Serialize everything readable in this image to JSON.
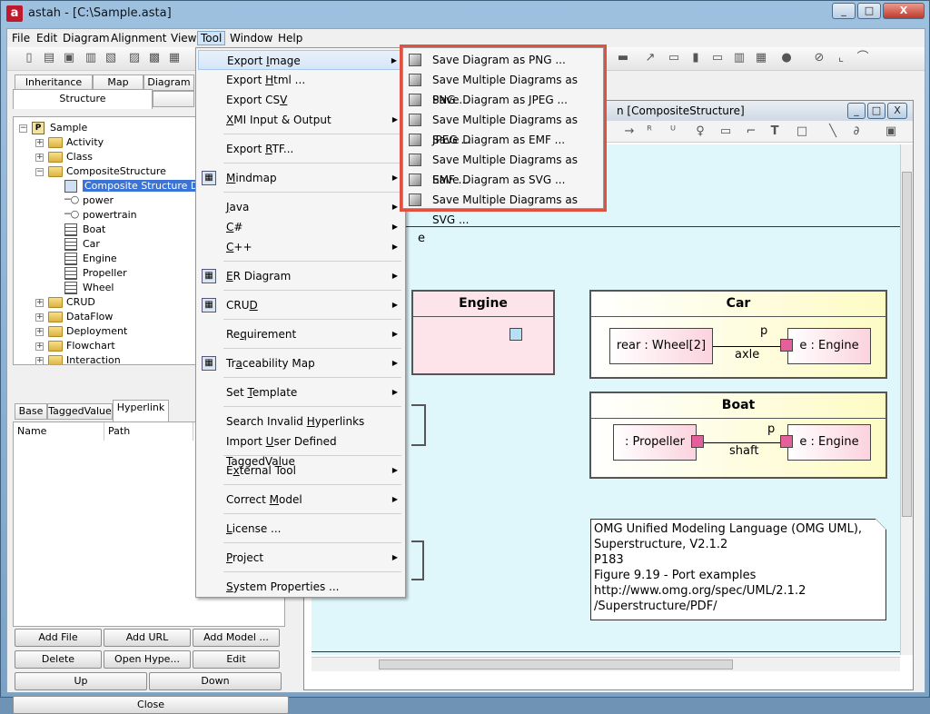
{
  "window": {
    "app_icon_text": "a",
    "title": "astah - [C:\\Sample.asta]",
    "min_btn": "_",
    "max_btn": "□",
    "close_btn": "X"
  },
  "menubar": [
    "File",
    "Edit",
    "Diagram",
    "Alignment",
    "View",
    "Tool",
    "Window",
    "Help"
  ],
  "left_tabs_row1": [
    "Inheritance",
    "Map",
    "Diagram"
  ],
  "left_tab_structure": "Structure",
  "tree": [
    {
      "label": "Sample",
      "indent": 0,
      "kind": "pkg",
      "exp": "-"
    },
    {
      "label": "Activity",
      "indent": 1,
      "kind": "folder",
      "exp": "+"
    },
    {
      "label": "Class",
      "indent": 1,
      "kind": "folder",
      "exp": "+"
    },
    {
      "label": "CompositeStructure",
      "indent": 1,
      "kind": "folder",
      "exp": "-"
    },
    {
      "label": "Composite Structure Diagr",
      "indent": 2,
      "kind": "diagram",
      "selected": true
    },
    {
      "label": "power",
      "indent": 2,
      "kind": "port"
    },
    {
      "label": "powertrain",
      "indent": 2,
      "kind": "port"
    },
    {
      "label": "Boat",
      "indent": 2,
      "kind": "class"
    },
    {
      "label": "Car",
      "indent": 2,
      "kind": "class"
    },
    {
      "label": "Engine",
      "indent": 2,
      "kind": "class"
    },
    {
      "label": "Propeller",
      "indent": 2,
      "kind": "class"
    },
    {
      "label": "Wheel",
      "indent": 2,
      "kind": "class"
    },
    {
      "label": "CRUD",
      "indent": 1,
      "kind": "folder",
      "exp": "+"
    },
    {
      "label": "DataFlow",
      "indent": 1,
      "kind": "folder",
      "exp": "+"
    },
    {
      "label": "Deployment",
      "indent": 1,
      "kind": "folder",
      "exp": "+"
    },
    {
      "label": "Flowchart",
      "indent": 1,
      "kind": "folder",
      "exp": "+"
    },
    {
      "label": "Interaction",
      "indent": 1,
      "kind": "folder",
      "exp": "+"
    }
  ],
  "prop_tabs": [
    "Base",
    "TaggedValue",
    "Hyperlink"
  ],
  "prop_columns": [
    "Name",
    "Path"
  ],
  "buttons": {
    "add_file": "Add File",
    "add_url": "Add URL",
    "add_model": "Add Model ...",
    "delete": "Delete",
    "open_hyper": "Open Hype...",
    "edit": "Edit",
    "up": "Up",
    "down": "Down",
    "close": "Close"
  },
  "tool_menu": [
    {
      "label": "Export Image",
      "mn": "I",
      "arrow": true,
      "hl": true
    },
    {
      "label": "Export Html ...",
      "mn": "H"
    },
    {
      "label": "Export CSV",
      "mn": "V"
    },
    {
      "label": "XMI Input & Output",
      "mn": "X",
      "arrow": true
    },
    {
      "sep": true
    },
    {
      "label": "Export RTF...",
      "mn": "R"
    },
    {
      "sep": true
    },
    {
      "label": "Mindmap",
      "mn": "M",
      "arrow": true,
      "icon": true
    },
    {
      "sep": true
    },
    {
      "label": "Java",
      "mn": "J",
      "arrow": true
    },
    {
      "label": "C#",
      "mn": "C",
      "arrow": true
    },
    {
      "label": "C++",
      "mn": "C",
      "arrow": true
    },
    {
      "sep": true
    },
    {
      "label": "ER Diagram",
      "mn": "E",
      "arrow": true,
      "icon": true
    },
    {
      "sep": true
    },
    {
      "label": "CRUD",
      "mn": "D",
      "arrow": true,
      "icon": true
    },
    {
      "sep": true
    },
    {
      "label": "Requirement",
      "mn": "q",
      "arrow": true
    },
    {
      "sep": true
    },
    {
      "label": "Traceability Map",
      "mn": "a",
      "arrow": true,
      "icon": true
    },
    {
      "sep": true
    },
    {
      "label": "Set Template",
      "mn": "T",
      "arrow": true
    },
    {
      "sep": true
    },
    {
      "label": "Search Invalid Hyperlinks",
      "mn": "H"
    },
    {
      "label": "Import User Defined TaggedValue",
      "mn": "U"
    },
    {
      "sep": true
    },
    {
      "label": "External Tool",
      "mn": "x",
      "arrow": true
    },
    {
      "sep": true
    },
    {
      "label": "Correct Model",
      "mn": "M",
      "arrow": true
    },
    {
      "sep": true
    },
    {
      "label": "License ...",
      "mn": "L"
    },
    {
      "sep": true
    },
    {
      "label": "Project",
      "mn": "P",
      "arrow": true
    },
    {
      "sep": true
    },
    {
      "label": "System Properties ...",
      "mn": "S"
    }
  ],
  "export_submenu": [
    "Save Diagram as PNG ...",
    "Save Multiple Diagrams as PNG ...",
    "Save Diagram as JPEG ...",
    "Save Multiple Diagrams as JPEG ...",
    "Save Diagram as EMF ...",
    "Save Multiple Diagrams as EMF ...",
    "Save Diagram as SVG ...",
    "Save Multiple Diagrams as SVG ..."
  ],
  "diagram": {
    "title_tail": "n [CompositeStructure]",
    "engine_title": "Engine",
    "car": {
      "title": "Car",
      "part_left": "rear : Wheel[2]",
      "part_right": "e : Engine",
      "port_label": "p",
      "connector_label": "axle"
    },
    "boat": {
      "title": "Boat",
      "part_left": ": Propeller",
      "part_right": "e : Engine",
      "port_label": "p",
      "connector_label": "shaft"
    },
    "note_lines": [
      "OMG Unified Modeling Language (OMG UML),",
      "Superstructure, V2.1.2",
      "P183",
      "Figure 9.19 - Port examples",
      "http://www.omg.org/spec/UML/2.1.2",
      "/Superstructure/PDF/"
    ],
    "partial_text": "e"
  },
  "colors": {
    "highlight": "#e0523f",
    "canvas": "#dff6fb",
    "class_fill": "#fdfbc4",
    "engine_fill": "#fde3ea"
  }
}
